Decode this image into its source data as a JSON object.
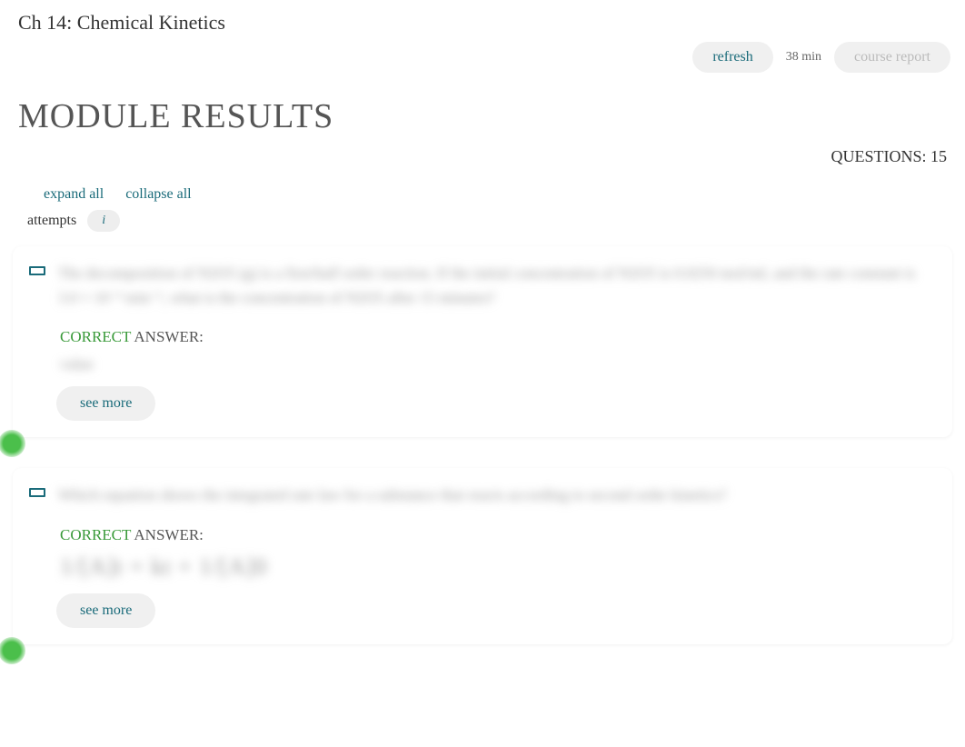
{
  "header": {
    "chapter_title": "Ch 14: Chemical Kinetics"
  },
  "top_actions": {
    "refresh_label": "refresh",
    "time_label": "38 min",
    "report_label": "course report"
  },
  "module": {
    "heading": "MODULE RESULTS",
    "questions_label": "QUESTIONS:",
    "questions_count": "15"
  },
  "controls": {
    "expand_label": "expand all",
    "collapse_label": "collapse all",
    "attempts_label": "attempts",
    "info_symbol": "i"
  },
  "questions": [
    {
      "prompt_blurred": "The decomposition of N2O5 (g) is a first/half order reaction. If the initial concentration of N2O5 is 0.0250 mol/mL and the rate constant is 3.0 × 10⁻³ min⁻¹, what is the concentration of N2O5 after 15 minutes?",
      "correct_label": "CORRECT",
      "answer_label": " ANSWER:",
      "answer_blurred": "value",
      "see_more_label": "see more",
      "status": "correct"
    },
    {
      "prompt_blurred": "Which equation shows the integrated rate law for a substance that reacts according to second order kinetics?",
      "correct_label": "CORRECT",
      "answer_label": " ANSWER:",
      "answer_blurred": "1/[A]t = kt + 1/[A]0",
      "see_more_label": "see more",
      "status": "correct"
    }
  ]
}
